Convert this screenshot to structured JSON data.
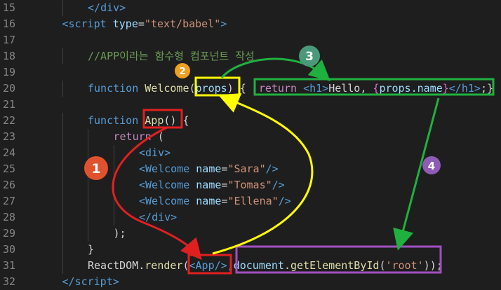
{
  "lines": [
    {
      "n": "15",
      "indent": 2,
      "tokens": [
        [
          "</",
          "tag"
        ],
        [
          "div",
          "tag"
        ],
        [
          ">",
          "tag"
        ]
      ]
    },
    {
      "n": "16",
      "indent": 1,
      "tokens": [
        [
          "<",
          "tag"
        ],
        [
          "script",
          "tag"
        ],
        [
          " ",
          "txt"
        ],
        [
          "type",
          "attr"
        ],
        [
          "=",
          "pun"
        ],
        [
          "\"text/babel\"",
          "str"
        ],
        [
          ">",
          "tag"
        ]
      ]
    },
    {
      "n": "17",
      "indent": 0,
      "tokens": []
    },
    {
      "n": "18",
      "indent": 2,
      "tokens": [
        [
          "//APP이라는 함수형 컴포넌트 작성",
          "cmt"
        ]
      ]
    },
    {
      "n": "19",
      "indent": 0,
      "tokens": []
    },
    {
      "n": "20",
      "indent": 2,
      "tokens": [
        [
          "function",
          "kw"
        ],
        [
          " ",
          "txt"
        ],
        [
          "Welcome",
          "fn"
        ],
        [
          "(",
          "pun"
        ],
        [
          "props",
          "attr"
        ],
        [
          ")",
          "pun"
        ],
        [
          " ",
          "txt"
        ],
        [
          "{",
          "pun"
        ],
        [
          "  ",
          "txt"
        ],
        [
          "return",
          "ctl"
        ],
        [
          " ",
          "txt"
        ],
        [
          "<",
          "tag"
        ],
        [
          "h1",
          "tag"
        ],
        [
          ">",
          "tag"
        ],
        [
          "Hello, ",
          "txt"
        ],
        [
          "{",
          "brace-hl"
        ],
        [
          "props.name",
          "attr"
        ],
        [
          "}",
          "brace-hl"
        ],
        [
          "</",
          "tag"
        ],
        [
          "h1",
          "tag"
        ],
        [
          ">",
          "tag"
        ],
        [
          ";",
          "pun"
        ],
        [
          "}",
          "pun"
        ]
      ]
    },
    {
      "n": "21",
      "indent": 0,
      "tokens": []
    },
    {
      "n": "22",
      "indent": 2,
      "tokens": [
        [
          "function",
          "kw"
        ],
        [
          " ",
          "txt"
        ],
        [
          "App",
          "fn"
        ],
        [
          "()",
          "pun"
        ],
        [
          " ",
          "txt"
        ],
        [
          "{",
          "pun"
        ]
      ]
    },
    {
      "n": "23",
      "indent": 3,
      "tokens": [
        [
          "return",
          "ctl"
        ],
        [
          " ",
          "txt"
        ],
        [
          "(",
          "pun"
        ]
      ]
    },
    {
      "n": "24",
      "indent": 4,
      "tokens": [
        [
          "<",
          "tag"
        ],
        [
          "div",
          "tag"
        ],
        [
          ">",
          "tag"
        ]
      ]
    },
    {
      "n": "25",
      "indent": 4,
      "tokens": [
        [
          "<",
          "tag"
        ],
        [
          "Welcome",
          "tag"
        ],
        [
          " ",
          "txt"
        ],
        [
          "name",
          "attr"
        ],
        [
          "=",
          "pun"
        ],
        [
          "\"Sara\"",
          "str"
        ],
        [
          "/>",
          "tag"
        ]
      ]
    },
    {
      "n": "26",
      "indent": 4,
      "tokens": [
        [
          "<",
          "tag"
        ],
        [
          "Welcome",
          "tag"
        ],
        [
          " ",
          "txt"
        ],
        [
          "name",
          "attr"
        ],
        [
          "=",
          "pun"
        ],
        [
          "\"Tomas\"",
          "str"
        ],
        [
          "/>",
          "tag"
        ]
      ]
    },
    {
      "n": "27",
      "indent": 4,
      "tokens": [
        [
          "<",
          "tag"
        ],
        [
          "Welcome",
          "tag"
        ],
        [
          " ",
          "txt"
        ],
        [
          "name",
          "attr"
        ],
        [
          "=",
          "pun"
        ],
        [
          "\"Ellena\"",
          "str"
        ],
        [
          "/>",
          "tag"
        ]
      ]
    },
    {
      "n": "28",
      "indent": 4,
      "tokens": [
        [
          "</",
          "tag"
        ],
        [
          "div",
          "tag"
        ],
        [
          ">",
          "tag"
        ]
      ]
    },
    {
      "n": "29",
      "indent": 3,
      "tokens": [
        [
          ");",
          "pun"
        ]
      ]
    },
    {
      "n": "30",
      "indent": 2,
      "tokens": [
        [
          "}",
          "pun"
        ]
      ]
    },
    {
      "n": "31",
      "indent": 2,
      "tokens": [
        [
          "ReactDOM",
          "txt"
        ],
        [
          ".",
          "pun"
        ],
        [
          "render",
          "fn"
        ],
        [
          "(",
          "pun"
        ],
        [
          "<",
          "tag"
        ],
        [
          "App",
          "tag"
        ],
        [
          "/>",
          "tag"
        ],
        [
          ",",
          "pun"
        ],
        [
          "document",
          "attr"
        ],
        [
          ".",
          "pun"
        ],
        [
          "getElementById",
          "fn"
        ],
        [
          "(",
          "pun"
        ],
        [
          "'root'",
          "str"
        ],
        [
          ")",
          "pun"
        ],
        [
          ");",
          "pun"
        ]
      ]
    },
    {
      "n": "32",
      "indent": 1,
      "tokens": [
        [
          "</",
          "tag"
        ],
        [
          "script",
          "tag"
        ],
        [
          ">",
          "tag"
        ]
      ]
    }
  ],
  "annotations": {
    "badges": [
      {
        "label": "1",
        "color": "#e0522e"
      },
      {
        "label": "2",
        "color": "#f0a020"
      },
      {
        "label": "3",
        "color": "#4a9a7a"
      },
      {
        "label": "4",
        "color": "#8e5bb5"
      }
    ],
    "colors": {
      "red": "#e02020",
      "yellow": "#ffff00",
      "green": "#20b040",
      "purple": "#a050c0"
    }
  }
}
